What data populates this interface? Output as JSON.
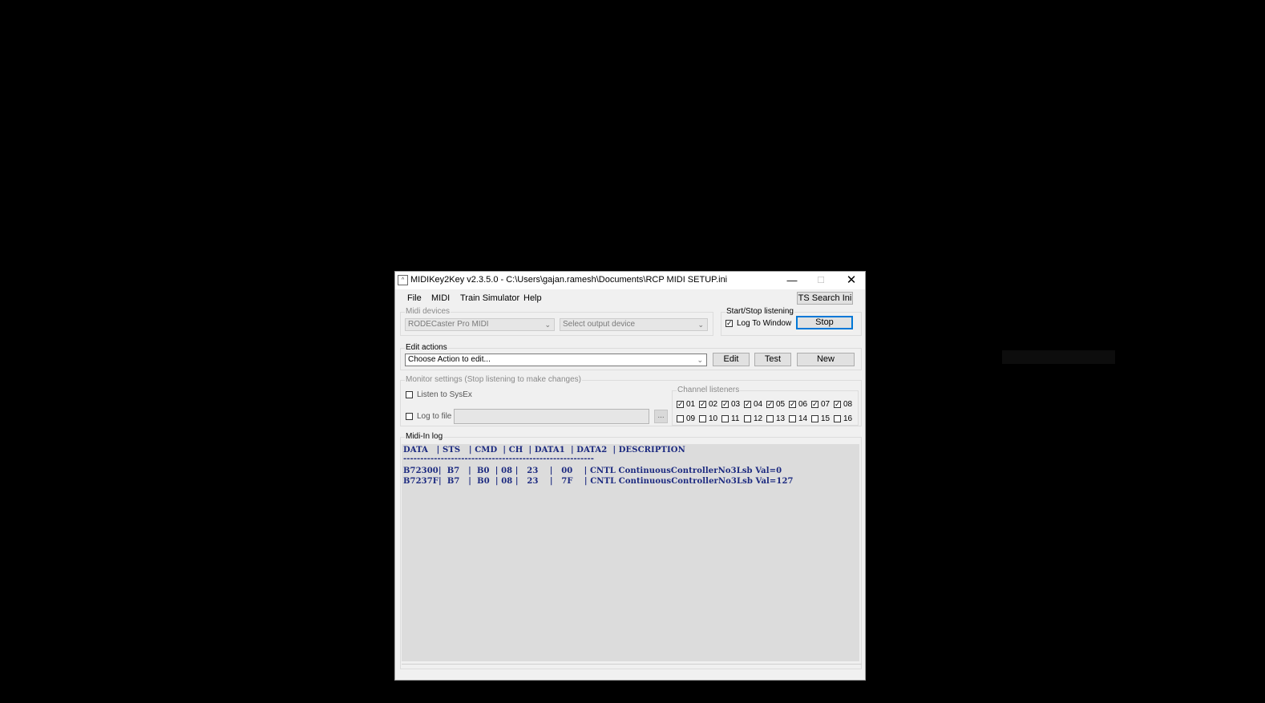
{
  "window": {
    "title": "MIDIKey2Key v2.3.5.0 - C:\\Users\\gajan.ramesh\\Documents\\RCP MIDI SETUP.ini",
    "app_icon_glyph": "^",
    "controls": {
      "minimize": "—",
      "maximize": "☐",
      "close": "✕"
    }
  },
  "menu": {
    "items": [
      "File",
      "MIDI",
      "Train Simulator",
      "Help"
    ],
    "ts_search_button": "TS Search Ini"
  },
  "midi_devices": {
    "title": "Midi devices",
    "input_device": "RODECaster Pro MIDI",
    "output_device": "Select output device"
  },
  "listening": {
    "title": "Start/Stop listening",
    "log_to_window_label": "Log To Window",
    "log_to_window_checked": true,
    "stop_button": "Stop"
  },
  "edit_actions": {
    "title": "Edit actions",
    "action_select": "Choose Action to edit...",
    "edit_button": "Edit",
    "test_button": "Test",
    "new_button": "New"
  },
  "monitor": {
    "title": "Monitor settings (Stop listening to make changes)",
    "sysex_label": "Listen to SysEx",
    "log_file_label": "Log to file",
    "browse_label": "...",
    "channels_title": "Channel listeners",
    "channels_row1": [
      "01",
      "02",
      "03",
      "04",
      "05",
      "06",
      "07",
      "08"
    ],
    "channels_row2": [
      "09",
      "10",
      "11",
      "12",
      "13",
      "14",
      "15",
      "16"
    ],
    "channels_row1_checked": true,
    "channels_row2_checked": false
  },
  "midi_log": {
    "title": "Midi-In log",
    "header": "DATA   | STS   | CMD  | CH  | DATA1  | DATA2  | DESCRIPTION",
    "separator": "--------------------------------------------------------",
    "rows": [
      "B72300|  B7   |  B0  | 08 |   23    |   00    | CNTL ContinuousControllerNo3Lsb Val=0",
      "B7237F|  B7   |  B0  | 08 |   23    |   7F    | CNTL ContinuousControllerNo3Lsb Val=127"
    ]
  }
}
